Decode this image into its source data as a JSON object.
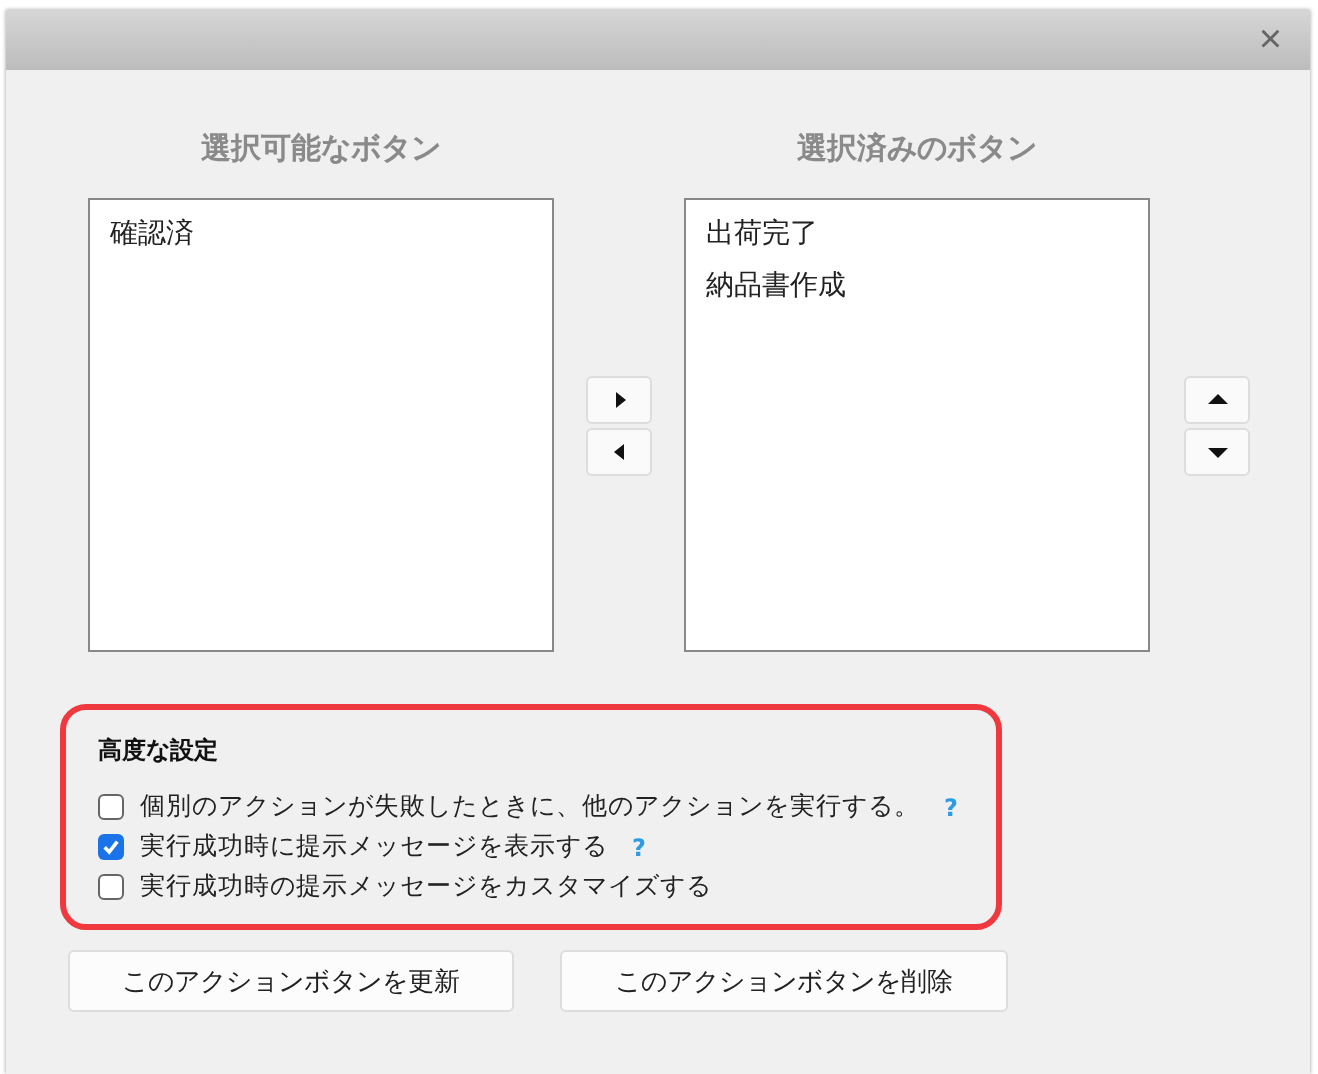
{
  "dialog": {
    "close": "×"
  },
  "available": {
    "heading": "選択可能なボタン",
    "items": [
      {
        "label": "確認済",
        "selected": false
      }
    ]
  },
  "chosen": {
    "heading": "選択済みのボタン",
    "items": [
      {
        "label": "出荷完了",
        "selected": false
      },
      {
        "label": "納品書作成",
        "selected": false
      }
    ]
  },
  "advanced": {
    "heading": "高度な設定",
    "highlighted": true,
    "options": [
      {
        "label": "個別のアクションが失敗したときに、他のアクションを実行する。",
        "checked": false,
        "help": "?"
      },
      {
        "label": "実行成功時に提示メッセージを表示する",
        "checked": true,
        "help": "?"
      },
      {
        "label": "実行成功時の提示メッセージをカスタマイズする",
        "checked": false
      }
    ]
  },
  "buttons": [
    "このアクションボタンを更新",
    "このアクションボタンを削除"
  ]
}
